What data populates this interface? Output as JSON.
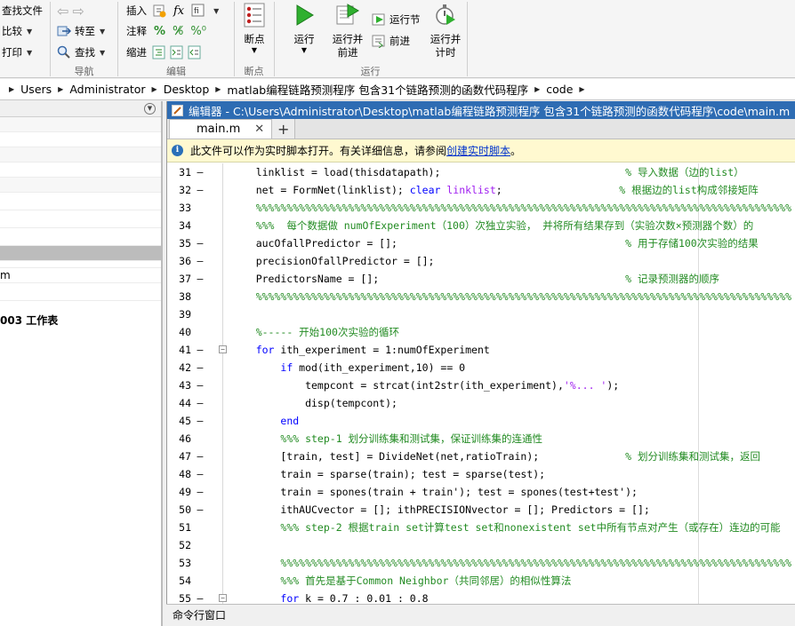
{
  "ribbon": {
    "left_items": [
      "查找文件",
      "比较",
      "打印"
    ],
    "nav_items": [
      "转至",
      "查找"
    ],
    "edit_items": [
      "插入",
      "注释",
      "缩进"
    ],
    "breakpoint_label": "断点",
    "run_items": {
      "run": "运行",
      "run_advance": "运行并\n前进",
      "run_section": "运行节",
      "advance": "前进",
      "run_time": "运行并\n计时"
    },
    "groups": {
      "nav": "导航",
      "edit": "编辑",
      "breakpoints": "断点",
      "run": "运行"
    }
  },
  "address": {
    "crumbs": [
      "Users",
      "Administrator",
      "Desktop",
      "matlab编程链路预测程序 包含31个链路预测的函数代码程序",
      "code"
    ]
  },
  "left_panel": {
    "items": [
      "",
      "",
      "",
      "",
      "",
      "",
      "",
      "",
      "",
      "",
      "m",
      "",
      "",
      "003 工作表"
    ]
  },
  "editor": {
    "title": "编辑器 - C:\\Users\\Administrator\\Desktop\\matlab编程链路预测程序 包含31个链路预测的函数代码程序\\code\\main.m",
    "tab": "main.m",
    "info_text": "此文件可以作为实时脚本打开。有关详细信息，请参阅 ",
    "info_link": "创建实时脚本",
    "info_end": "。",
    "lines": [
      {
        "n": "31",
        "d": "–",
        "t": "    linklist = load(thisdatapath);                              % 导入数据（边的list）"
      },
      {
        "n": "32",
        "d": "–",
        "t": "    net = FormNet(linklist); clear linklist;                   % 根据边的list构成邻接矩阵"
      },
      {
        "n": "33",
        "d": "",
        "t": "    %%%%%%%%%%%%%%%%%%%%%%%%%%%%%%%%%%%%%%%%%%%%%%%%%%%%%%%%%%%%%%%%%%%%%%%%%%%%%%%%%%%%%%%"
      },
      {
        "n": "34",
        "d": "",
        "t": "    %%%  每个数据做 numOfExperiment（100）次独立实验， 并将所有结果存到（实验次数×预测器个数）的"
      },
      {
        "n": "35",
        "d": "–",
        "t": "    aucOfallPredictor = [];                                     % 用于存储100次实验的结果"
      },
      {
        "n": "36",
        "d": "–",
        "t": "    precisionOfallPredictor = [];"
      },
      {
        "n": "37",
        "d": "–",
        "t": "    PredictorsName = [];                                        % 记录预测器的顺序"
      },
      {
        "n": "38",
        "d": "",
        "t": "    %%%%%%%%%%%%%%%%%%%%%%%%%%%%%%%%%%%%%%%%%%%%%%%%%%%%%%%%%%%%%%%%%%%%%%%%%%%%%%%%%%%%%%%"
      },
      {
        "n": "39",
        "d": "",
        "t": ""
      },
      {
        "n": "40",
        "d": "",
        "t": "    %----- 开始100次实验的循环"
      },
      {
        "n": "41",
        "d": "–",
        "t": "    for ith_experiment = 1:numOfExperiment"
      },
      {
        "n": "42",
        "d": "–",
        "t": "        if mod(ith_experiment,10) == 0"
      },
      {
        "n": "43",
        "d": "–",
        "t": "            tempcont = strcat(int2str(ith_experiment),'%... ');"
      },
      {
        "n": "44",
        "d": "–",
        "t": "            disp(tempcont);"
      },
      {
        "n": "45",
        "d": "–",
        "t": "        end"
      },
      {
        "n": "46",
        "d": "",
        "t": "        %%% step-1 划分训练集和测试集，保证训练集的连通性"
      },
      {
        "n": "47",
        "d": "–",
        "t": "        [train, test] = DivideNet(net,ratioTrain);              % 划分训练集和测试集，返回"
      },
      {
        "n": "48",
        "d": "–",
        "t": "        train = sparse(train); test = sparse(test);"
      },
      {
        "n": "49",
        "d": "–",
        "t": "        train = spones(train + train'); test = spones(test+test');"
      },
      {
        "n": "50",
        "d": "–",
        "t": "        ithAUCvector = []; ithPRECISIONvector = []; Predictors = [];"
      },
      {
        "n": "51",
        "d": "",
        "t": "        %%% step-2 根据train set计算test set和nonexistent set中所有节点对产生（或存在）连边的可能"
      },
      {
        "n": "52",
        "d": "",
        "t": ""
      },
      {
        "n": "53",
        "d": "",
        "t": "        %%%%%%%%%%%%%%%%%%%%%%%%%%%%%%%%%%%%%%%%%%%%%%%%%%%%%%%%%%%%%%%%%%%%%%%%%%%%%%%%%%%"
      },
      {
        "n": "54",
        "d": "",
        "t": "        %%% 首先是基于Common Neighbor（共同邻居）的相似性算法"
      },
      {
        "n": "55",
        "d": "–",
        "t": "        for k = 0.7 : 0.01 : 0.8"
      }
    ]
  },
  "command_window": {
    "title": "命令行窗口"
  }
}
